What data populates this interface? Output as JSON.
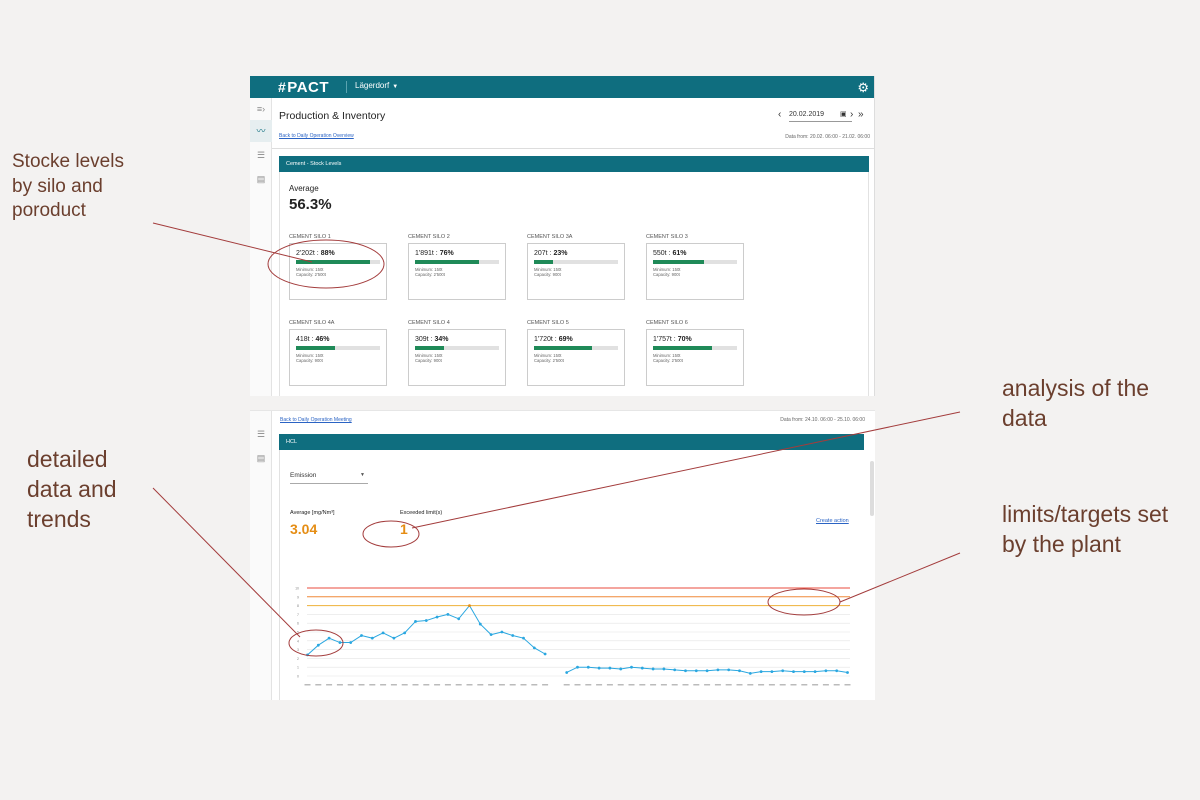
{
  "notes": {
    "stock_lines": [
      "Stocke levels",
      "by silo and",
      "poroduct"
    ],
    "detailed_lines": [
      "detailed",
      "data and",
      "trends"
    ],
    "analysis_lines": [
      "analysis of the",
      "data"
    ],
    "limits_lines": [
      "limits/targets set",
      "by the plant"
    ]
  },
  "app": {
    "logo": "PACT",
    "plant": "Lägerdorf",
    "gear_icon": "gear-icon"
  },
  "production": {
    "title": "Production & Inventory",
    "back_link": "Back to Daily Operation Overview",
    "date": "20.02.2019",
    "data_from": "Data from: 20.02. 06:00 - 21.02. 06:00",
    "panel_title": "Cement - Stock Levels",
    "average_label": "Average",
    "average_value": "56.3%",
    "silos": [
      {
        "name": "CEMENT SILO 1",
        "amount": "2'202t",
        "pct_label": "88%",
        "pct": 0.88,
        "minimum": "Minimum: 150t",
        "capacity": "Capacity: 2'500t"
      },
      {
        "name": "CEMENT SILO 2",
        "amount": "1'891t",
        "pct_label": "76%",
        "pct": 0.76,
        "minimum": "Minimum: 150t",
        "capacity": "Capacity: 2'500t"
      },
      {
        "name": "CEMENT SILO 3A",
        "amount": "207t",
        "pct_label": "23%",
        "pct": 0.23,
        "minimum": "Minimum: 150t",
        "capacity": "Capacity: 900t"
      },
      {
        "name": "CEMENT SILO 3",
        "amount": "550t",
        "pct_label": "61%",
        "pct": 0.61,
        "minimum": "Minimum: 150t",
        "capacity": "Capacity: 900t"
      },
      {
        "name": "CEMENT SILO 4A",
        "amount": "418t",
        "pct_label": "46%",
        "pct": 0.46,
        "minimum": "Minimum: 150t",
        "capacity": "Capacity: 900t"
      },
      {
        "name": "CEMENT SILO 4",
        "amount": "309t",
        "pct_label": "34%",
        "pct": 0.34,
        "minimum": "Minimum: 150t",
        "capacity": "Capacity: 900t"
      },
      {
        "name": "CEMENT SILO 5",
        "amount": "1'720t",
        "pct_label": "69%",
        "pct": 0.69,
        "minimum": "Minimum: 150t",
        "capacity": "Capacity: 2'500t"
      },
      {
        "name": "CEMENT SILO 6",
        "amount": "1'757t",
        "pct_label": "70%",
        "pct": 0.7,
        "minimum": "Minimum: 150t",
        "capacity": "Capacity: 2'500t"
      }
    ]
  },
  "hcl": {
    "back_link": "Back to Daily Operation Meeting",
    "data_from": "Data from: 24.10. 06:00 - 25.10. 06:00",
    "panel_title": "HCL",
    "emission_select": "Emission",
    "average_label": "Average [mg/Nm³]",
    "average_value": "3.04",
    "exceeded_label": "Exceeded limit(s)",
    "exceeded_value": "1",
    "create_action": "Create action"
  },
  "chart_data": {
    "type": "line",
    "ylim": [
      0,
      10
    ],
    "yticks": [
      "0",
      "1",
      "2",
      "3",
      "4",
      "5",
      "6",
      "7",
      "8",
      "9",
      "10"
    ],
    "limits": [
      {
        "value": 10,
        "color": "#e84b3c"
      },
      {
        "value": 9,
        "color": "#f08a3a"
      },
      {
        "value": 8,
        "color": "#f0b23a"
      }
    ],
    "series": [
      {
        "values": [
          2.4,
          3.5,
          4.3,
          3.8,
          3.8,
          4.6,
          4.3,
          4.9,
          4.3,
          4.9,
          6.2,
          6.3,
          6.7,
          7.0,
          6.5,
          8.0,
          5.9,
          4.7,
          5.0,
          4.6,
          4.3,
          3.2,
          2.5,
          null,
          0.4,
          1.0,
          1.0,
          0.9,
          0.9,
          0.8,
          1.0,
          0.9,
          0.8,
          0.8,
          0.7,
          0.6,
          0.6,
          0.6,
          0.7,
          0.7,
          0.6,
          0.3,
          0.5,
          0.5,
          0.6,
          0.5,
          0.5,
          0.5,
          0.6,
          0.6,
          0.4
        ],
        "exceeded_index": 15,
        "color": "#2aa7e0"
      }
    ]
  }
}
